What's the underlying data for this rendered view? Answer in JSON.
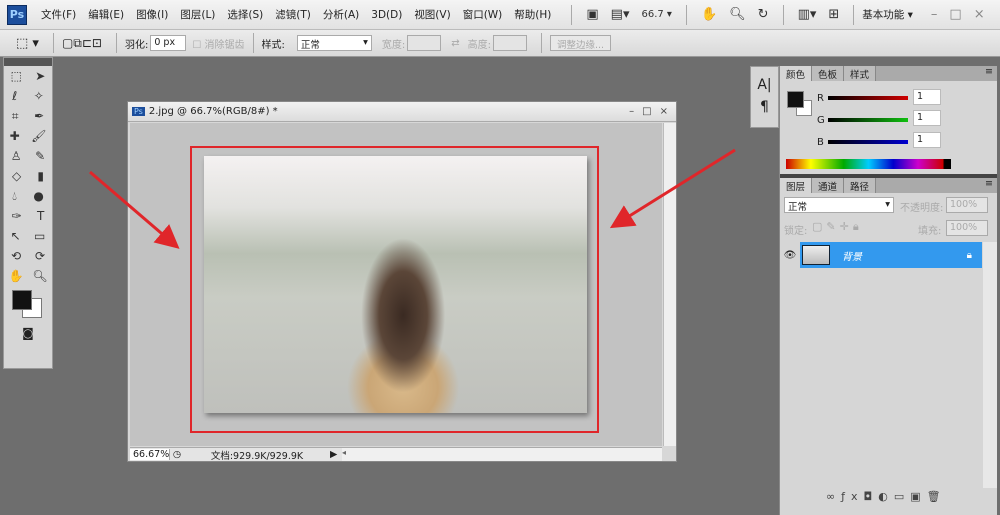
{
  "app": {
    "logo": "Ps"
  },
  "menu": [
    "文件(F)",
    "编辑(E)",
    "图像(I)",
    "图层(L)",
    "选择(S)",
    "滤镜(T)",
    "分析(A)",
    "3D(D)",
    "视图(V)",
    "窗口(W)",
    "帮助(H)"
  ],
  "appbar": {
    "zoom": "66.7",
    "workspace": "基本功能"
  },
  "options": {
    "feather_label": "羽化:",
    "feather_value": "0 px",
    "antialias_label": "消除锯齿",
    "style_label": "样式:",
    "style_value": "正常",
    "width_label": "宽度:",
    "height_label": "高度:",
    "refine_edge": "调整边缘..."
  },
  "document": {
    "title": "2.jpg @ 66.7%(RGB/8#) *",
    "zoom": "66.67%",
    "doc_info": "文档:929.9K/929.9K"
  },
  "color_panel": {
    "tabs": [
      "颜色",
      "色板",
      "样式"
    ],
    "channels": [
      {
        "label": "R",
        "value": "1",
        "color": "#d00000"
      },
      {
        "label": "G",
        "value": "1",
        "color": "#10c010"
      },
      {
        "label": "B",
        "value": "1",
        "color": "#0000d0"
      }
    ]
  },
  "layers_panel": {
    "tabs": [
      "图层",
      "通道",
      "路径"
    ],
    "blend_mode": "正常",
    "opacity_label": "不透明度:",
    "opacity": "100%",
    "lock_label": "锁定:",
    "fill_label": "填充:",
    "fill": "100%",
    "layers": [
      {
        "name": "背景",
        "locked": true,
        "visible": true
      }
    ]
  },
  "colors": {
    "annotation": "#e0262a",
    "selection": "#3399ee"
  }
}
